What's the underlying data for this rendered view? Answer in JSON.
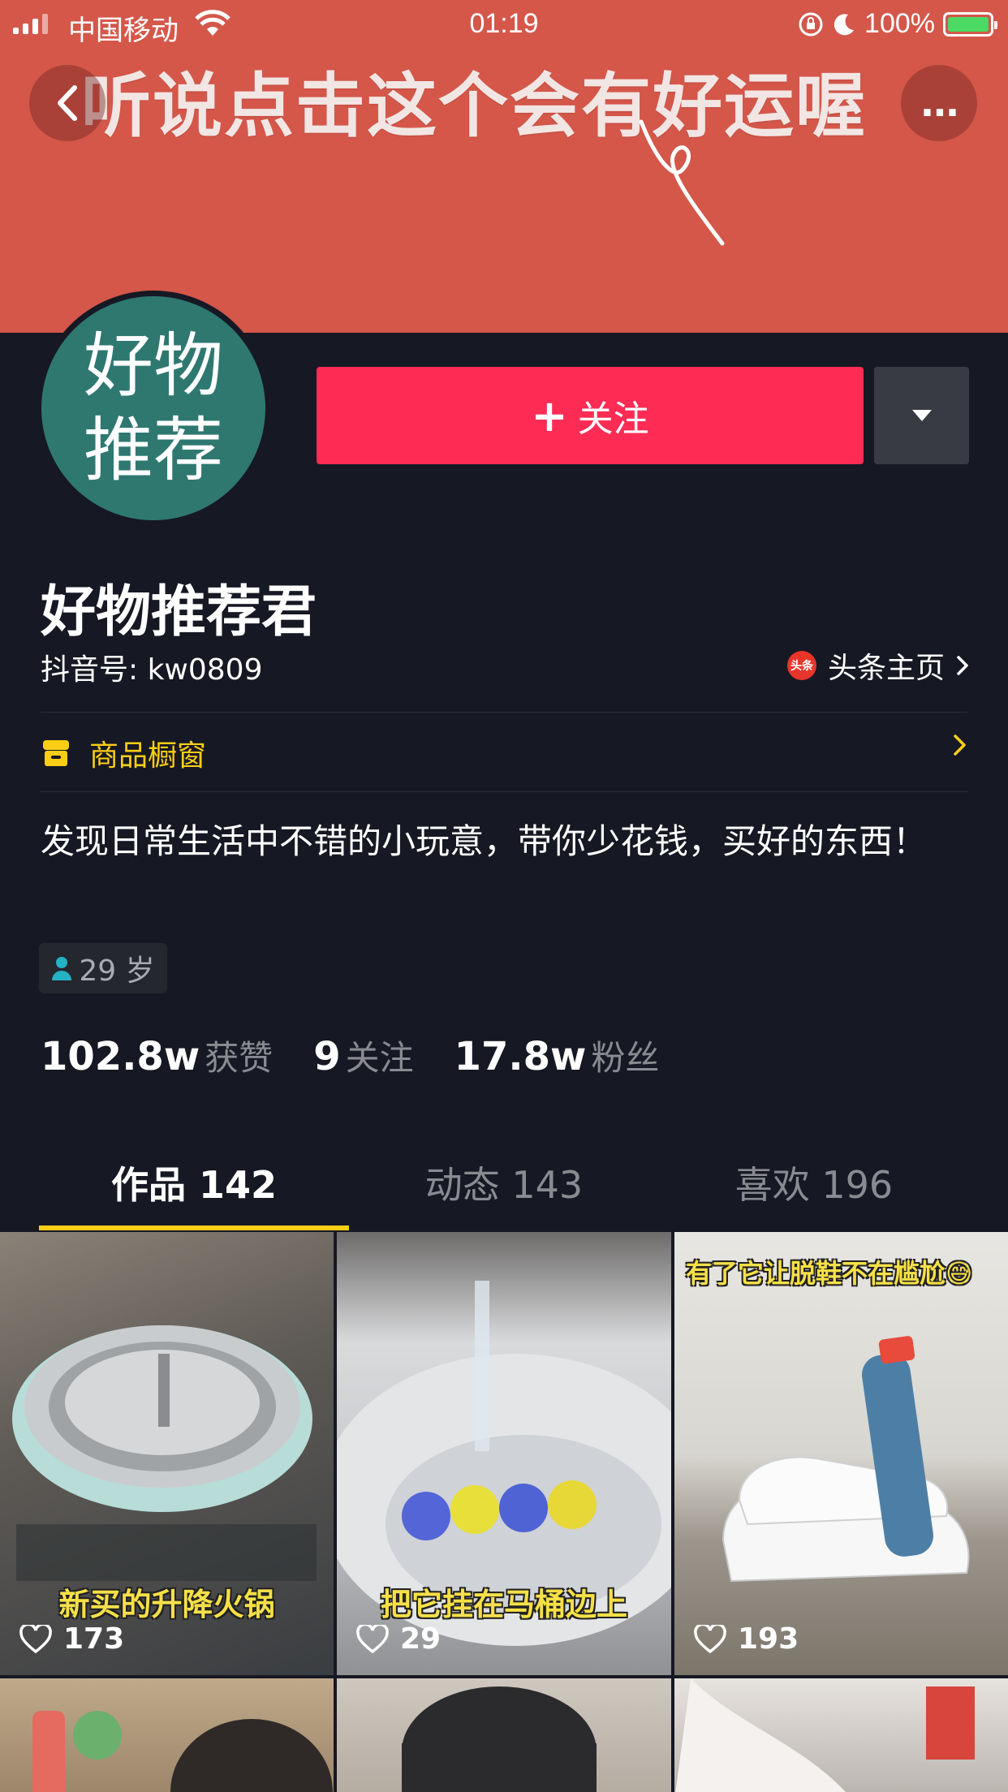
{
  "status_bar": {
    "carrier": "中国移动",
    "time": "01:19",
    "battery": "100%"
  },
  "banner": {
    "text": "听说点击这个会有好运喔"
  },
  "header": {
    "more_label": "..."
  },
  "profile": {
    "avatar_line1": "好物",
    "avatar_line2": "推荐",
    "follow_label": "关注",
    "name": "好物推荐君",
    "douyin_id": "抖音号: kw0809",
    "toutiao_logo": "头条",
    "toutiao_label": "头条主页",
    "shop_label": "商品橱窗",
    "bio": "发现日常生活中不错的小玩意，带你少花钱，买好的东西！",
    "age": "29 岁"
  },
  "stats": [
    {
      "value": "102.8w",
      "label": "获赞"
    },
    {
      "value": "9",
      "label": "关注"
    },
    {
      "value": "17.8w",
      "label": "粉丝"
    }
  ],
  "tabs": [
    {
      "label": "作品 142",
      "active": true
    },
    {
      "label": "动态 143",
      "active": false
    },
    {
      "label": "喜欢 196",
      "active": false
    }
  ],
  "videos": [
    {
      "caption": "新买的升降火锅",
      "likes": "173"
    },
    {
      "caption": "把它挂在马桶边上",
      "likes": "29"
    },
    {
      "caption": "有了它让脱鞋不在尴尬😅",
      "likes": "193"
    }
  ],
  "colors": {
    "accent": "#fe2c55",
    "highlight": "#face15",
    "background": "#161823"
  }
}
